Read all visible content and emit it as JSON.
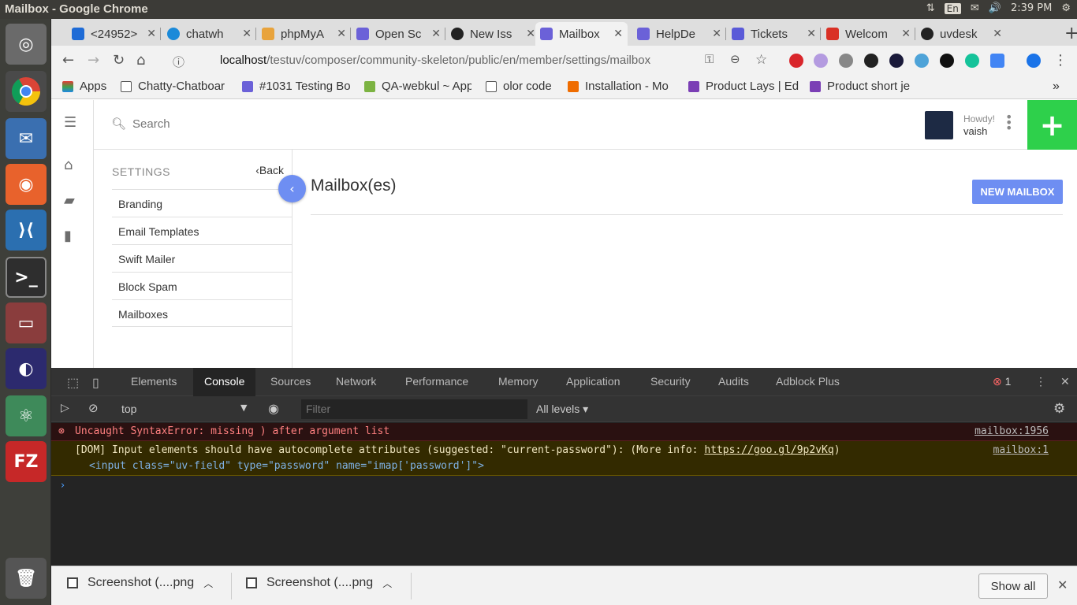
{
  "system_bar": {
    "title": "Mailbox - Google Chrome",
    "keyboard": "En",
    "time": "2:39 PM"
  },
  "browser_tabs": [
    {
      "label": "<24952>",
      "color": "#1e6bd6"
    },
    {
      "label": "chatwh",
      "color": "#1b8ad9"
    },
    {
      "label": "phpMyA",
      "color": "#e8a33c"
    },
    {
      "label": "Open Sc",
      "color": "#6b61d8"
    },
    {
      "label": "New Iss",
      "color": "#222222"
    },
    {
      "label": "Mailbox",
      "color": "#6b61d8"
    },
    {
      "label": "HelpDe",
      "color": "#6b61d8"
    },
    {
      "label": "Tickets",
      "color": "#5a5ad8"
    },
    {
      "label": "Welcom",
      "color": "#d93025"
    },
    {
      "label": "uvdesk",
      "color": "#222222"
    }
  ],
  "omnibox": {
    "host": "localhost",
    "path": "/testuv/composer/community-skeleton/public/en/member/settings/mailbox"
  },
  "bookmarks": [
    {
      "label": "Apps"
    },
    {
      "label": "Chatty-Chatboar"
    },
    {
      "label": "#1031 Testing Bo"
    },
    {
      "label": "QA-webkul ~ App"
    },
    {
      "label": "olor code"
    },
    {
      "label": "Installation - Mo"
    },
    {
      "label": "Product Lays | Ed"
    },
    {
      "label": "Product short je"
    }
  ],
  "header": {
    "search_placeholder": "Search",
    "howdy": "Howdy!",
    "username": "vaish",
    "add_label": "+"
  },
  "settings": {
    "title": "SETTINGS",
    "back": "Back",
    "items": [
      "Branding",
      "Email Templates",
      "Swift Mailer",
      "Block Spam",
      "Mailboxes"
    ]
  },
  "main": {
    "title": "Mailbox(es)",
    "new_button": "NEW MAILBOX"
  },
  "devtools": {
    "tabs": [
      "Elements",
      "Console",
      "Sources",
      "Network",
      "Performance",
      "Memory",
      "Application",
      "Security",
      "Audits",
      "Adblock Plus"
    ],
    "error_count": "1",
    "context": "top",
    "filter_placeholder": "Filter",
    "levels": "All levels",
    "error_message": "Uncaught SyntaxError: missing ) after argument list",
    "error_source": "mailbox:1956",
    "warning_message": "[DOM] Input elements should have autocomplete attributes (suggested: \"current-password\"): (More info: ",
    "warning_link": "https://goo.gl/9p2vKq",
    "warning_tail": ")",
    "warning_source": "mailbox:1",
    "warning_code": "<input class=\"uv-field\" type=\"password\" name=\"imap['password']\">"
  },
  "downloads": {
    "items": [
      "Screenshot (....png",
      "Screenshot (....png"
    ],
    "show_all": "Show all"
  },
  "colors": {
    "accent": "#6e8ef2",
    "add": "#2ed04b",
    "error": "#ff8080"
  }
}
